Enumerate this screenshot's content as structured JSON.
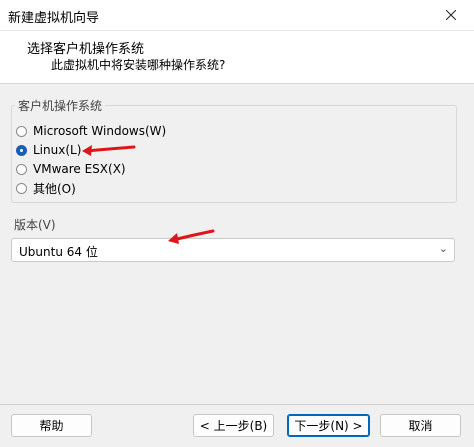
{
  "window": {
    "title": "新建虚拟机向导"
  },
  "header": {
    "title": "选择客户机操作系统",
    "subtitle": "此虚拟机中将安装哪种操作系统?"
  },
  "guest_os": {
    "group_label": "客户机操作系统",
    "options": [
      {
        "label": "Microsoft Windows(W)",
        "selected": false
      },
      {
        "label": "Linux(L)",
        "selected": true
      },
      {
        "label": "VMware ESX(X)",
        "selected": false
      },
      {
        "label": "其他(O)",
        "selected": false
      }
    ]
  },
  "version": {
    "group_label": "版本(V)",
    "selected_value": "Ubuntu 64 位"
  },
  "buttons": {
    "help": "帮助",
    "back": "< 上一步(B)",
    "next": "下一步(N) >",
    "cancel": "取消"
  },
  "colors": {
    "accent": "#1a5fb4",
    "annotation_arrow": "#e0151b"
  }
}
